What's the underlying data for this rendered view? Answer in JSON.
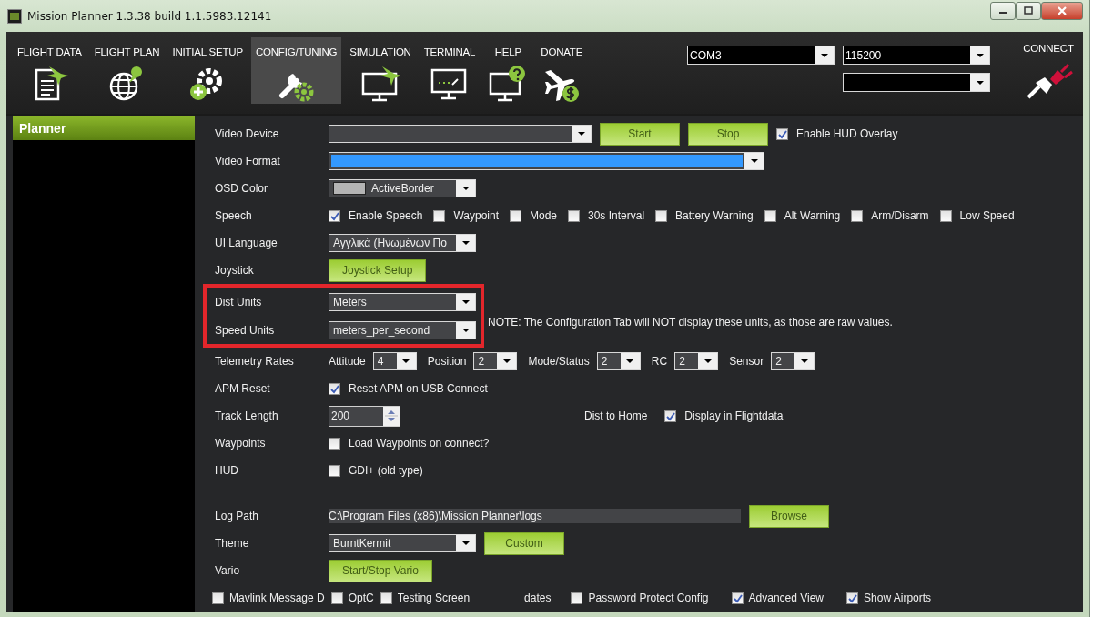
{
  "window": {
    "title": "Mission Planner 1.3.38 build 1.1.5983.12141"
  },
  "menu": [
    {
      "label": "FLIGHT DATA",
      "selected": false
    },
    {
      "label": "FLIGHT PLAN",
      "selected": false
    },
    {
      "label": "INITIAL SETUP",
      "selected": false
    },
    {
      "label": "CONFIG/TUNING",
      "selected": true
    },
    {
      "label": "SIMULATION",
      "selected": false
    },
    {
      "label": "TERMINAL",
      "selected": false
    },
    {
      "label": "HELP",
      "selected": false
    },
    {
      "label": "DONATE",
      "selected": false
    }
  ],
  "connection": {
    "port": "COM3",
    "baud": "115200",
    "connect_label": "CONNECT"
  },
  "sidebar": {
    "items": [
      {
        "label": "Planner",
        "selected": true
      }
    ]
  },
  "sections": [
    {
      "rows": [
        {
          "kind": "row",
          "label": "Video Device",
          "controls": [
            {
              "kind": "wide-combo"
            },
            {
              "kind": "button",
              "label": "Start"
            },
            {
              "kind": "button",
              "label": "Stop"
            },
            {
              "kind": "checkbox",
              "label": "Enable HUD Overlay",
              "checked": true
            }
          ]
        },
        {
          "kind": "row",
          "label": "Video Format",
          "controls": [
            {
              "kind": "full-combo",
              "highlighted": true
            }
          ]
        },
        {
          "kind": "row",
          "label": "OSD Color",
          "controls": [
            {
              "kind": "color-combo",
              "value": "ActiveBorder",
              "color": "#b4b4b4"
            }
          ]
        },
        {
          "kind": "row",
          "label": "Speech",
          "controls": [
            {
              "kind": "checkbox",
              "label": "Enable Speech",
              "checked": true
            },
            {
              "kind": "checkbox",
              "label": "Waypoint",
              "checked": false
            },
            {
              "kind": "checkbox",
              "label": "Mode",
              "checked": false
            },
            {
              "kind": "checkbox",
              "label": "30s Interval",
              "checked": false
            },
            {
              "kind": "checkbox",
              "label": "Battery Warning",
              "checked": false
            },
            {
              "kind": "checkbox",
              "label": "Alt Warning",
              "checked": false
            },
            {
              "kind": "checkbox",
              "label": "Arm/Disarm",
              "checked": false
            },
            {
              "kind": "checkbox",
              "label": "Low Speed",
              "checked": false
            }
          ]
        },
        {
          "kind": "row",
          "label": "UI Language",
          "controls": [
            {
              "kind": "combo",
              "value": "Αγγλικά (Ηνωμένων Πο"
            }
          ]
        },
        {
          "kind": "row",
          "label": "Joystick",
          "controls": [
            {
              "kind": "button",
              "label": "Joystick Setup"
            }
          ]
        },
        {
          "kind": "highlight",
          "note": "NOTE: The Configuration Tab will NOT display these units, as those are raw values.",
          "rows": [
            {
              "kind": "row",
              "label": "Dist Units",
              "controls": [
                {
                  "kind": "combo",
                  "value": "Meters"
                }
              ]
            },
            {
              "kind": "row",
              "label": "Speed Units",
              "controls": [
                {
                  "kind": "combo",
                  "value": "meters_per_second"
                }
              ]
            }
          ]
        },
        {
          "kind": "row",
          "label": "Telemetry Rates",
          "controls": [
            {
              "kind": "rate",
              "label": "Attitude",
              "value": "4"
            },
            {
              "kind": "rate",
              "label": "Position",
              "value": "2"
            },
            {
              "kind": "rate",
              "label": "Mode/Status",
              "value": "2"
            },
            {
              "kind": "rate",
              "label": "RC",
              "value": "2"
            },
            {
              "kind": "rate",
              "label": "Sensor",
              "value": "2"
            }
          ]
        },
        {
          "kind": "row",
          "label": "APM Reset",
          "controls": [
            {
              "kind": "checkbox",
              "label": "Reset APM on USB Connect",
              "checked": true
            }
          ]
        },
        {
          "kind": "row",
          "label": "Track Length",
          "controls": [
            {
              "kind": "spinner",
              "value": "200"
            },
            {
              "kind": "text",
              "label": "Dist to Home"
            },
            {
              "kind": "checkbox",
              "label": "Display in Flightdata",
              "checked": true
            }
          ]
        },
        {
          "kind": "row",
          "label": "Waypoints",
          "controls": [
            {
              "kind": "checkbox",
              "label": "Load Waypoints on connect?",
              "checked": false
            }
          ]
        },
        {
          "kind": "row",
          "label": "HUD",
          "controls": [
            {
              "kind": "checkbox",
              "label": "GDI+ (old type)",
              "checked": false
            }
          ]
        }
      ]
    },
    {
      "rows": [
        {
          "kind": "row",
          "label": "Log Path",
          "controls": [
            {
              "kind": "path",
              "value": "C:\\Program Files (x86)\\Mission Planner\\logs"
            },
            {
              "kind": "button",
              "label": "Browse"
            }
          ]
        },
        {
          "kind": "row",
          "label": "Theme",
          "controls": [
            {
              "kind": "combo",
              "value": "BurntKermit"
            },
            {
              "kind": "button",
              "label": "Custom"
            }
          ]
        },
        {
          "kind": "row",
          "label": "Vario",
          "controls": [
            {
              "kind": "button",
              "label": "Start/Stop Vario"
            }
          ]
        },
        {
          "kind": "options",
          "controls": [
            {
              "kind": "checkbox",
              "label": "Mavlink Message D",
              "checked": false
            },
            {
              "kind": "checkbox",
              "label": "OptC",
              "checked": false
            },
            {
              "kind": "checkbox",
              "label": "Testing Screen",
              "checked": false
            },
            {
              "kind": "text",
              "label": "dates"
            },
            {
              "kind": "checkbox",
              "label": "Password Protect Config",
              "checked": false
            },
            {
              "kind": "checkbox",
              "label": "Advanced View",
              "checked": true
            },
            {
              "kind": "checkbox",
              "label": "Show Airports",
              "checked": true
            }
          ]
        }
      ]
    }
  ]
}
